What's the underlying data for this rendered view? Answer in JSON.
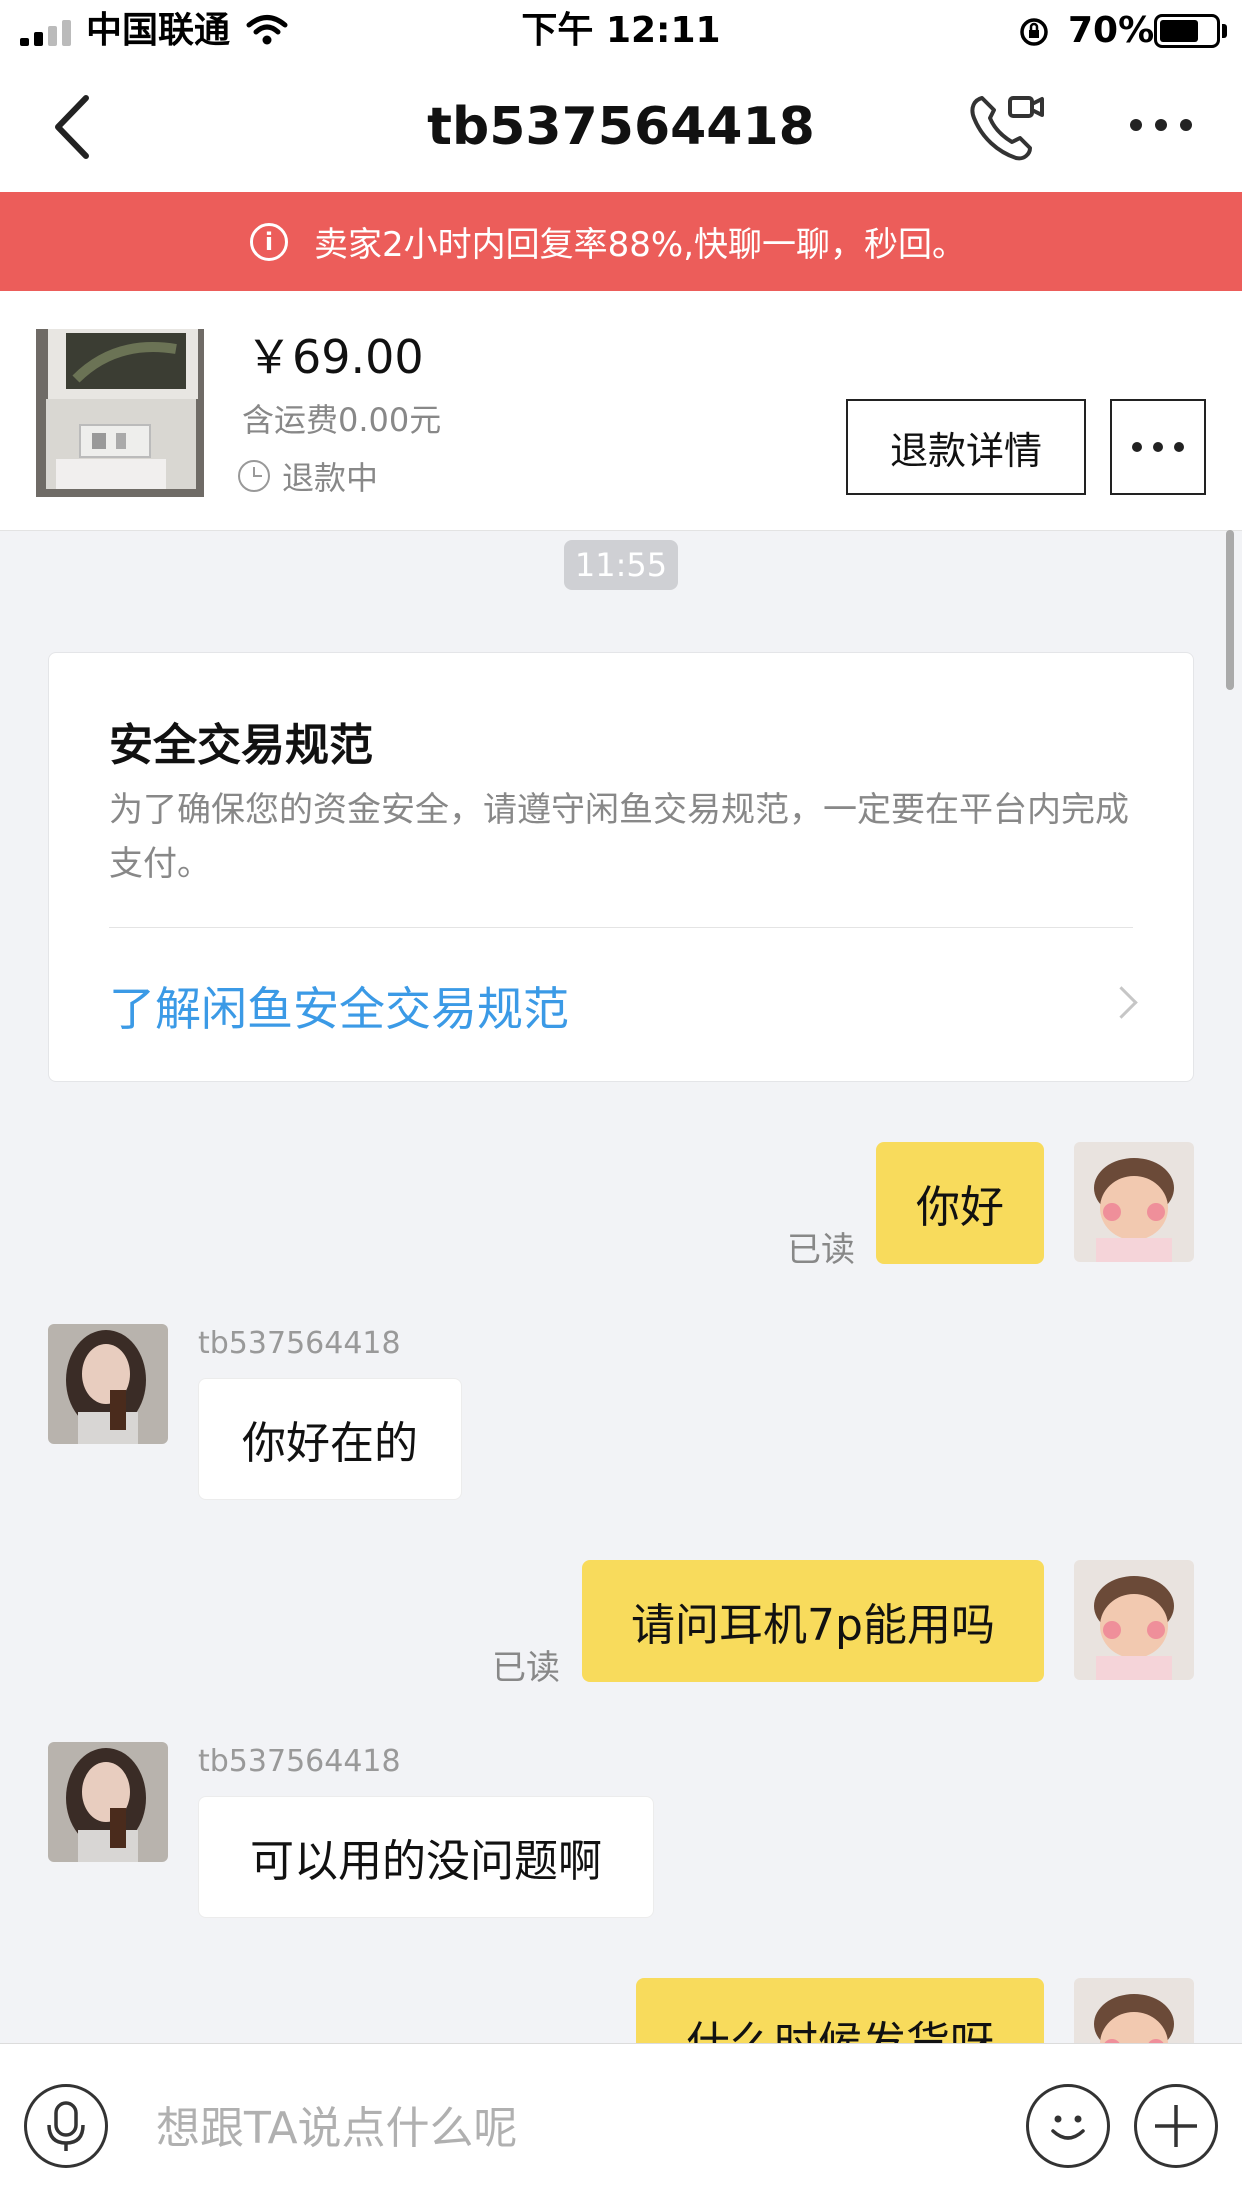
{
  "status_bar": {
    "carrier": "中国联通",
    "time": "下午 12:11",
    "battery": "70%",
    "battery_level": 0.7
  },
  "nav": {
    "title": "tb537564418",
    "back_icon": "chevron-left-icon",
    "call_icon": "video-call-icon",
    "more_icon": "more-dots-icon"
  },
  "notice": {
    "text": "卖家2小时内回复率88%,快聊一聊，秒回。"
  },
  "product": {
    "price": "￥69.00",
    "shipping": "含运费0.00元",
    "status": "退款中",
    "refund_button": "退款详情"
  },
  "chat": {
    "timestamp": "11:55",
    "safety_card": {
      "title": "安全交易规范",
      "body": "为了确保您的资金安全，请遵守闲鱼交易规范，一定要在平台内完成支付。",
      "link": "了解闲鱼安全交易规范"
    },
    "messages": [
      {
        "from": "me",
        "text": "你好",
        "read": "已读"
      },
      {
        "from": "them",
        "name": "tb537564418",
        "text": "你好在的"
      },
      {
        "from": "me",
        "text": "请问耳机7p能用吗",
        "read": "已读"
      },
      {
        "from": "them",
        "name": "tb537564418",
        "text": "可以用的没问题啊"
      },
      {
        "from": "me",
        "text": "什么时候发货呀"
      }
    ]
  },
  "input": {
    "placeholder": "想跟TA说点什么呢",
    "voice_icon": "microphone-icon",
    "emoji_icon": "smiley-icon",
    "plus_icon": "plus-icon"
  },
  "colors": {
    "notice_bg": "#ec5d5a",
    "my_bubble": "#f8db5c",
    "link": "#3b9ae6",
    "chat_bg": "#f2f3f6"
  }
}
